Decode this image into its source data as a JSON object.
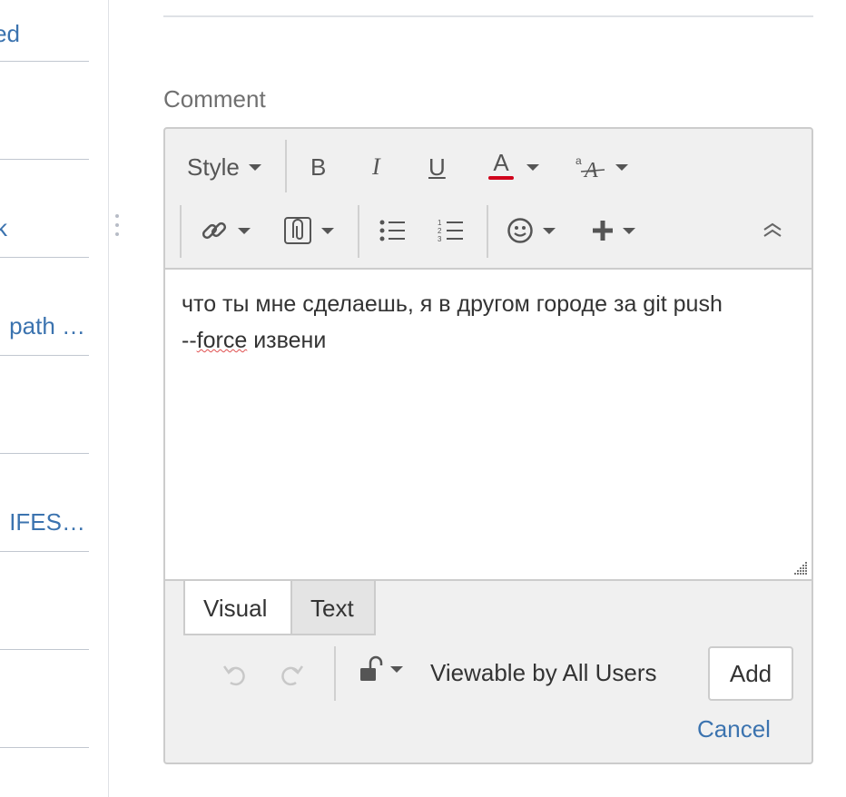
{
  "sidebar": {
    "items": [
      {
        "label": "ed"
      },
      {
        "label": ""
      },
      {
        "label": "k"
      },
      {
        "label": " path …"
      },
      {
        "label": ""
      },
      {
        "label": "IFES…"
      },
      {
        "label": ""
      }
    ]
  },
  "comment": {
    "label": "Comment",
    "toolbar": {
      "style_label": "Style",
      "bold_label": "B",
      "italic_label": "I",
      "underline_label": "U",
      "text_color_label": "A",
      "text_color_accent": "#d0021b"
    },
    "body": {
      "line1": "что ты мне сделаешь, я в другом городе за git push",
      "line2_prefix": "--",
      "line2_misspelled": "force",
      "line2_suffix": " извени"
    },
    "tabs": {
      "visual": "Visual",
      "text": "Text"
    },
    "footer": {
      "visibility": "Viewable by All Users",
      "add_label": "Add",
      "cancel_label": "Cancel"
    }
  },
  "colors": {
    "link": "#3b73af",
    "panel_bg": "#f0f0f0",
    "border": "#cccccc"
  },
  "icons": [
    "link-icon",
    "attachment-icon",
    "bullet-list-icon",
    "numbered-list-icon",
    "emoticon-icon",
    "insert-plus-icon",
    "collapse-toolbar-icon",
    "undo-icon",
    "redo-icon",
    "unlock-icon",
    "font-size-icon",
    "drag-handle-icon",
    "resize-grip-icon"
  ]
}
